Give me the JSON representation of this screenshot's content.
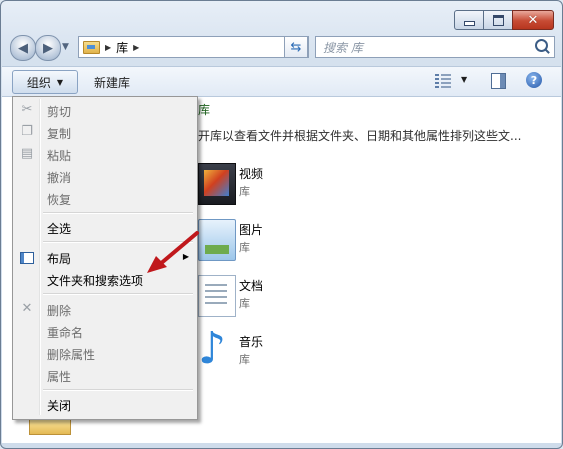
{
  "window": {
    "caption_buttons": {
      "minimize": "minimize",
      "maximize": "maximize",
      "close": "✕"
    }
  },
  "nav": {
    "back_icon": "back-arrow-icon",
    "forward_icon": "forward-arrow-icon",
    "breadcrumb": [
      "库"
    ],
    "search_placeholder": "搜索 库"
  },
  "toolbar": {
    "organize_label": "组织",
    "new_library_label": "新建库"
  },
  "menu": {
    "items": [
      {
        "label": "剪切",
        "enabled": false,
        "icon": "scissors-icon"
      },
      {
        "label": "复制",
        "enabled": false,
        "icon": "copy-icon"
      },
      {
        "label": "粘贴",
        "enabled": false,
        "icon": "paste-icon"
      },
      {
        "label": "撤消",
        "enabled": false
      },
      {
        "label": "恢复",
        "enabled": false
      },
      {
        "label": "全选",
        "enabled": true
      },
      {
        "label": "布局",
        "enabled": true,
        "icon": "layout-icon",
        "submenu": true
      },
      {
        "label": "文件夹和搜索选项",
        "enabled": true
      },
      {
        "label": "删除",
        "enabled": false,
        "icon": "delete-x-icon"
      },
      {
        "label": "重命名",
        "enabled": false
      },
      {
        "label": "删除属性",
        "enabled": false
      },
      {
        "label": "属性",
        "enabled": false
      },
      {
        "label": "关闭",
        "enabled": true
      }
    ]
  },
  "content": {
    "heading_fragment": "库",
    "description": "开库以查看文件并根据文件夹、日期和其他属性排列这些文...",
    "libraries": [
      {
        "name": "视频",
        "type": "库",
        "icon": "video-library-icon"
      },
      {
        "name": "图片",
        "type": "库",
        "icon": "pictures-library-icon"
      },
      {
        "name": "文档",
        "type": "库",
        "icon": "documents-library-icon"
      },
      {
        "name": "音乐",
        "type": "库",
        "icon": "music-library-icon"
      }
    ]
  },
  "annotation": {
    "color": "#c0181c"
  }
}
